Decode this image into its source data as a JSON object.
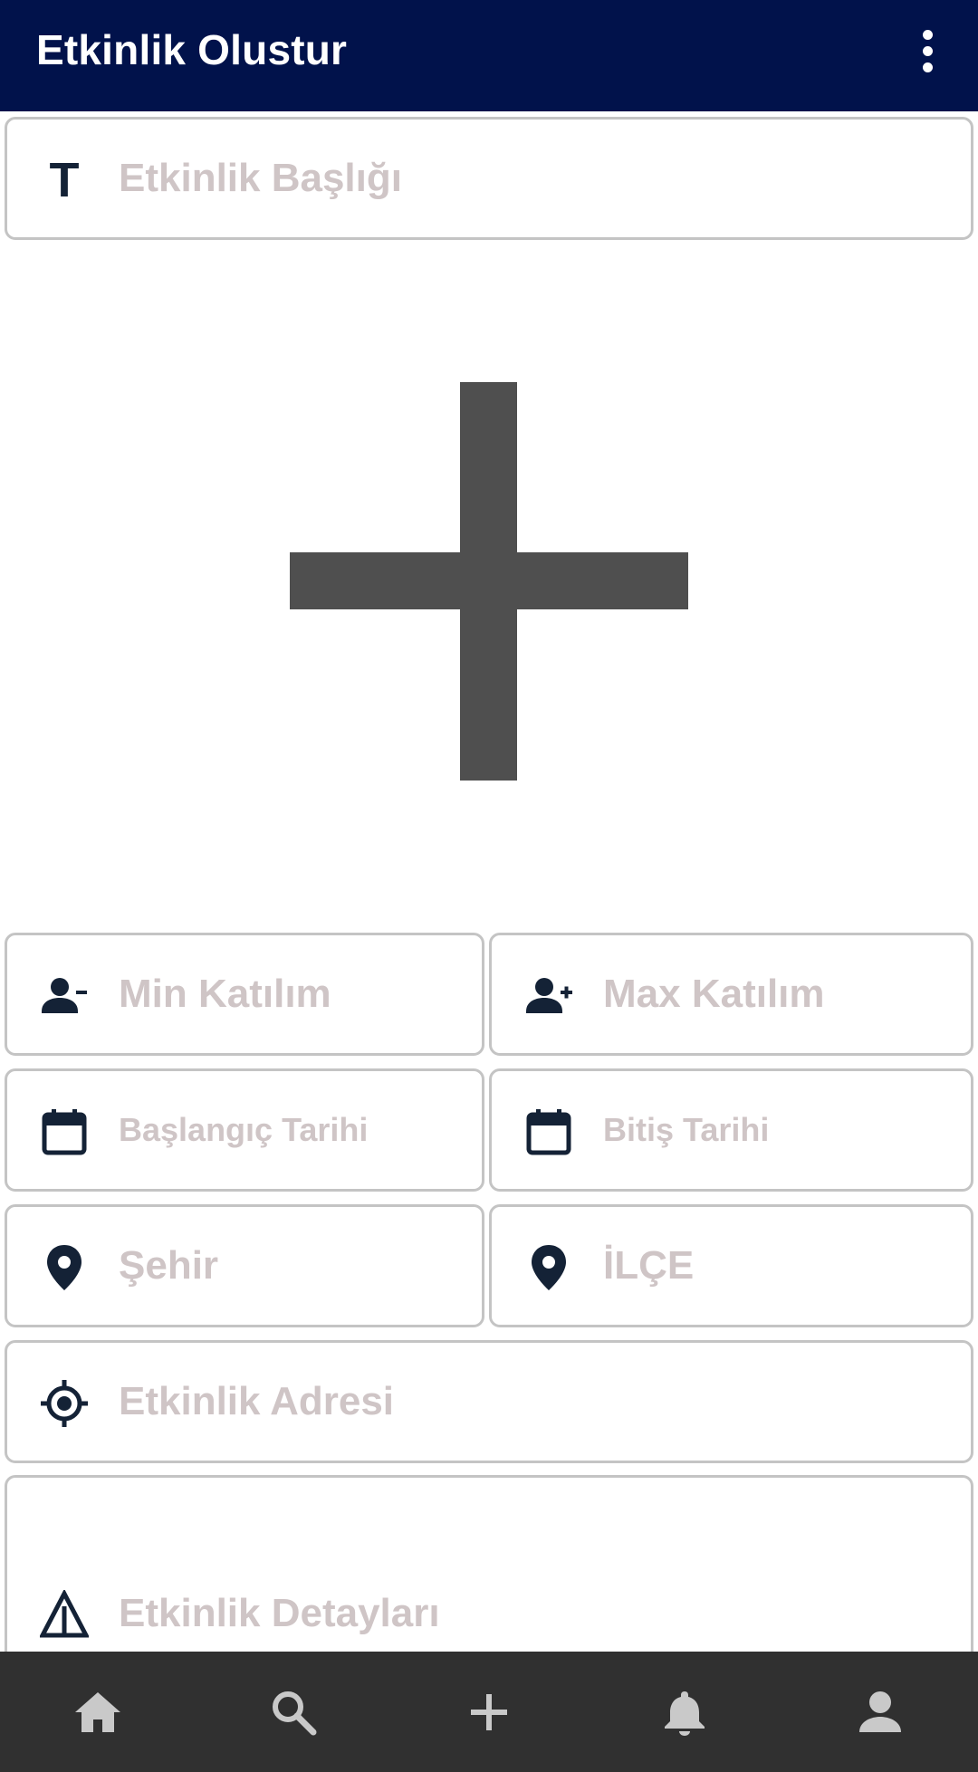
{
  "appbar": {
    "title": "Etkinlik Olustur",
    "menu_icon": "more-vert-icon",
    "background": "#01124b"
  },
  "form": {
    "title_placeholder": "Etkinlik Başlığı",
    "image_picker_icon": "add-icon",
    "min_participants_placeholder": "Min Katılım",
    "max_participants_placeholder": "Max Katılım",
    "start_date_placeholder": "Başlangıç Tarihi",
    "end_date_placeholder": "Bitiş Tarihi",
    "city_placeholder": "Şehir",
    "district_placeholder": "İLÇE",
    "address_placeholder": "Etkinlik Adresi",
    "details_placeholder": "Etkinlik Detayları",
    "title_icon_glyph": "T"
  },
  "bottom_nav": {
    "items": [
      {
        "icon": "home-icon"
      },
      {
        "icon": "search-icon"
      },
      {
        "icon": "add-icon"
      },
      {
        "icon": "notifications-icon"
      },
      {
        "icon": "person-icon"
      }
    ],
    "background": "#303030"
  },
  "colors": {
    "icon": "#142236",
    "placeholder": "#cfc5c6",
    "border": "#c4c4c4",
    "plus": "#4f4f4f",
    "nav_icon": "#c9c9c9"
  }
}
